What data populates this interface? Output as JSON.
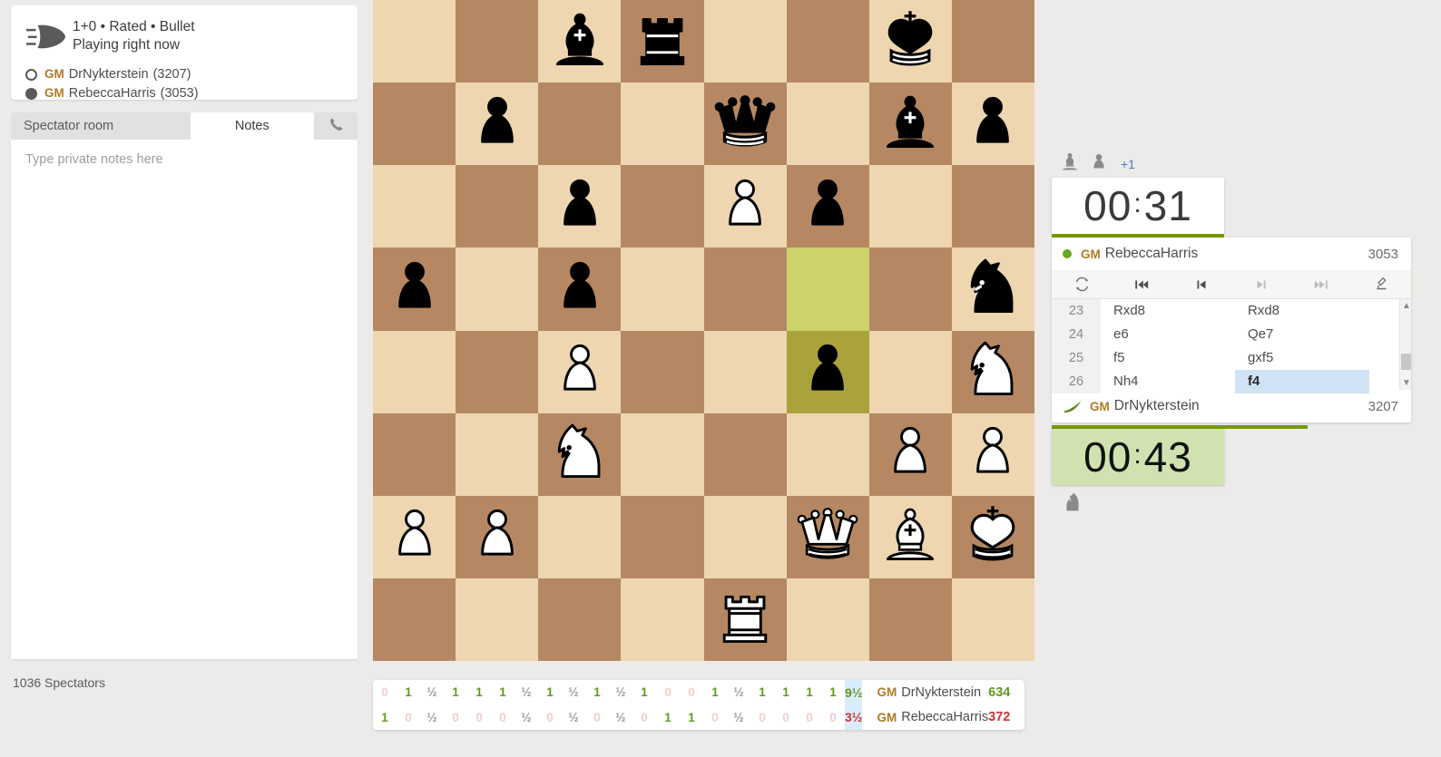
{
  "game_meta": {
    "icon": "bullet-icon",
    "time_control_line": "1+0 • Rated • Bullet",
    "status_line": "Playing right now",
    "white": {
      "title": "GM",
      "name": "DrNykterstein",
      "rating_paren": "(3207)"
    },
    "black": {
      "title": "GM",
      "name": "RebeccaHarris",
      "rating_paren": "(3053)"
    }
  },
  "tabs": {
    "spectator_room": "Spectator room",
    "notes": "Notes",
    "phone_icon": "phone-icon",
    "active": "Notes"
  },
  "notes": {
    "placeholder": "Type private notes here",
    "value": ""
  },
  "spectators": "1036 Spectators",
  "right": {
    "captured": {
      "pieces": [
        "bishop",
        "pawn"
      ],
      "advantage": "+1"
    },
    "top_player": {
      "title": "GM",
      "name": "RebeccaHarris",
      "rating": "3053",
      "clock": "00:31",
      "clock_h": "00",
      "clock_m": "31",
      "online": true
    },
    "bottom_player": {
      "title": "GM",
      "name": "DrNykterstein",
      "rating": "3207",
      "clock": "00:43",
      "clock_h": "00",
      "clock_m": "43",
      "icon": "wing-icon"
    },
    "controls": [
      {
        "name": "flip-board-icon",
        "enabled": true
      },
      {
        "name": "first-move-icon",
        "enabled": true
      },
      {
        "name": "previous-move-icon",
        "enabled": true
      },
      {
        "name": "next-move-icon",
        "enabled": false
      },
      {
        "name": "last-move-icon",
        "enabled": false
      },
      {
        "name": "analysis-board-icon",
        "enabled": true
      }
    ],
    "moves": [
      {
        "num": "23",
        "white": "Rxd8",
        "black": "Rxd8",
        "current": ""
      },
      {
        "num": "24",
        "white": "e6",
        "black": "Qe7",
        "current": ""
      },
      {
        "num": "25",
        "white": "f5",
        "black": "gxf5",
        "current": ""
      },
      {
        "num": "26",
        "white": "Nh4",
        "black": "f4",
        "current": "black"
      }
    ]
  },
  "board": {
    "orientation": "white",
    "highlight_from": "f5",
    "highlight_to": "f4",
    "rows": [
      [
        null,
        null,
        "bB",
        "bR",
        null,
        null,
        "bK",
        null
      ],
      [
        null,
        "bP",
        null,
        null,
        "bQ",
        null,
        "bB",
        "bP"
      ],
      [
        null,
        null,
        "bP",
        null,
        "wP",
        "bP",
        null,
        null
      ],
      [
        "bP",
        null,
        "bP",
        null,
        null,
        null,
        null,
        "bN"
      ],
      [
        null,
        null,
        "wP",
        null,
        null,
        "bP",
        null,
        "wN"
      ],
      [
        null,
        null,
        "wN",
        null,
        null,
        null,
        "wP",
        "wP"
      ],
      [
        "wP",
        "wP",
        null,
        null,
        null,
        "wQ",
        "wB",
        "wK"
      ],
      [
        null,
        null,
        null,
        null,
        "wR",
        null,
        null,
        null
      ]
    ]
  },
  "scorebar": {
    "group1": {
      "top": [
        "0",
        "1",
        "½",
        "1",
        "1",
        "1",
        "½"
      ],
      "bottom": [
        "1",
        "0",
        "½",
        "0",
        "0",
        "0",
        "½"
      ]
    },
    "group2": {
      "top": [
        "1",
        "½",
        "1",
        "½",
        "1",
        "0",
        "0",
        "1",
        "½",
        "1",
        "1",
        "1",
        "1"
      ],
      "bottom": [
        "0",
        "½",
        "0",
        "½",
        "0",
        "1",
        "1",
        "0",
        "½",
        "0",
        "0",
        "0",
        "0"
      ]
    },
    "totals": {
      "top": "9½",
      "bottom": "3½"
    },
    "rows": [
      {
        "title": "GM",
        "name": "DrNykterstein",
        "points": "634"
      },
      {
        "title": "GM",
        "name": "RebeccaHarris",
        "points": "372"
      }
    ]
  },
  "colors": {
    "light_square": "#edd6b0",
    "dark_square": "#b58863",
    "highlight_light": "#cdd26a",
    "highlight_dark": "#aaa23a",
    "accent_green": "#759900",
    "title_gold": "#b07b24",
    "clock_active": "#cfe2b0",
    "move_current": "#cfe3f5"
  }
}
